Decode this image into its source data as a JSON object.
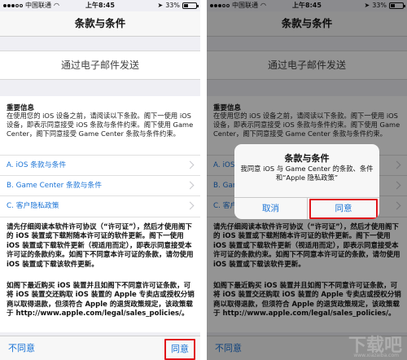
{
  "status": {
    "carrier": "中国联通",
    "time": "上午8:45",
    "battery": "33%"
  },
  "nav": {
    "title": "条款与条件"
  },
  "email_button": "通过电子邮件发送",
  "info": {
    "heading": "重要信息",
    "body": "在使用您的 iOS 设备之前，请阅读以下条款。阁下一使用 iOS 设备，即表示同意接受 iOS 条款与条件约束。阁下使用 Game Center，阁下同意接受 Game Center 条款与条件约束。"
  },
  "links": [
    {
      "label": "A. iOS 条款与条件"
    },
    {
      "label": "B. Game Center 条款与条件"
    },
    {
      "label": "C. 客户隐私政策"
    }
  ],
  "paragraphs": [
    "请先仔细阅读本软件许可协议（“许可证”），然后才使用阁下的 iOS 装置或下载附随本许可证的软件更新。阁下一使用 iOS 装置或下载软件更新（视适用而定），即表示同意接受本许可证的条款约束。如阁下不同意本许可证的条款，请勿使用 iOS 装置或下载该软件更新。",
    "如阁下最近购买 iOS 装置并且如阁下不同意许可证条款，可将 iOS 装置交还购取 iOS 装置的 Apple 专卖店或授权分销商以取得退款，但须符合 Apple 的退货政策规定，该政策载于 http://www.apple.com/legal/sales_policies/。"
  ],
  "toolbar": {
    "disagree": "不同意",
    "agree": "同意"
  },
  "alert": {
    "title": "条款与条件",
    "message": "我同意 iOS 与 Game Center 的条款、条件和“Apple 隐私政策”",
    "cancel": "取消",
    "agree": "同意"
  },
  "watermark": {
    "text": "下载吧",
    "url": "www.xiazaiba.com"
  },
  "colors": {
    "link": "#1a73d6",
    "highlight": "#e0141a",
    "background": "#efeff4"
  }
}
